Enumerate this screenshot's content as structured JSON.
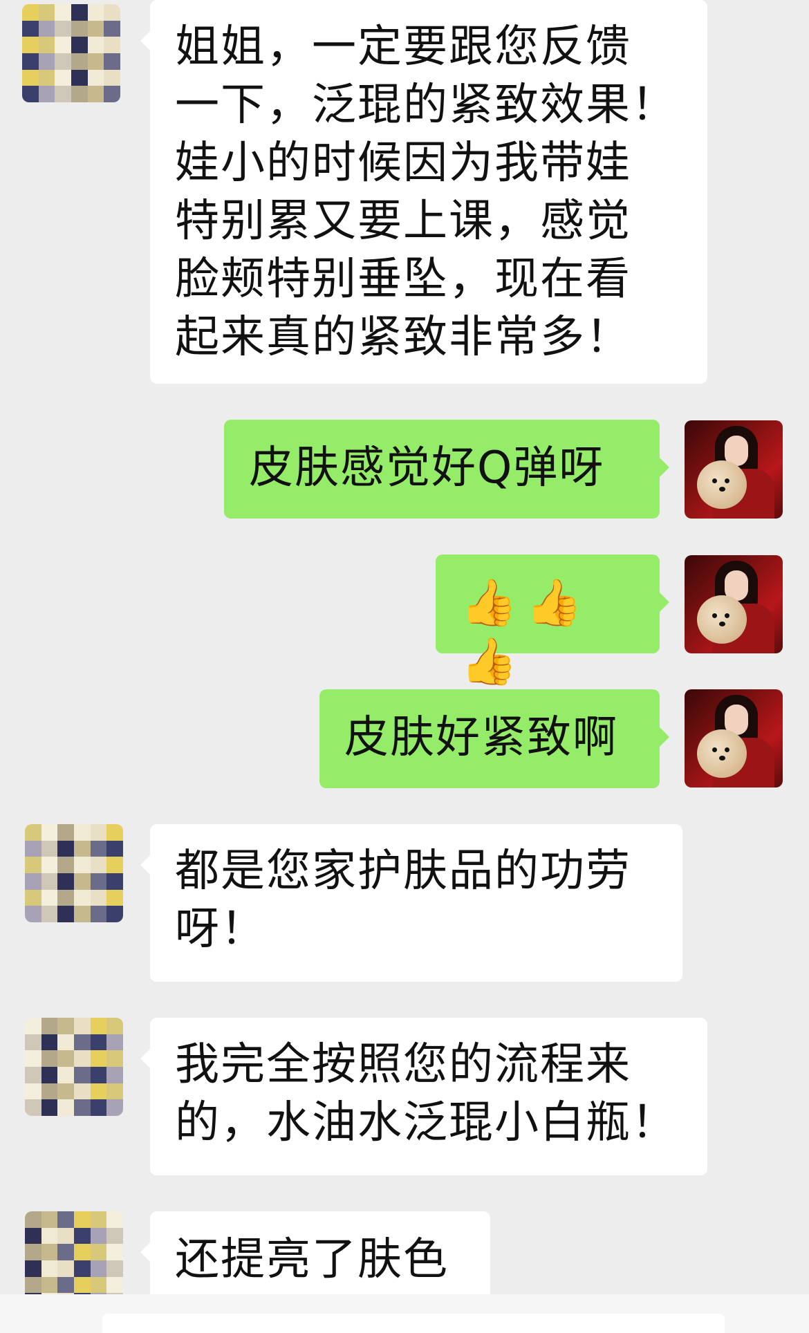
{
  "messages": [
    {
      "side": "in",
      "lines": [
        "姐姐，一定要跟您反馈",
        "一下，泛琨的紧致效果！",
        "娃小的时候因为我带娃",
        "特别累又要上课，感觉",
        "脸颊特别垂坠，现在看",
        "起来真的紧致非常多！"
      ]
    },
    {
      "side": "out",
      "text": "皮肤感觉好Q弹呀"
    },
    {
      "side": "out",
      "emoji": [
        "👍",
        "👍",
        "👍"
      ],
      "emoji_name": "thumbs-up"
    },
    {
      "side": "out",
      "text": "皮肤好紧致啊"
    },
    {
      "side": "in",
      "lines": [
        "都是您家护肤品的功劳",
        "呀！"
      ]
    },
    {
      "side": "in",
      "lines": [
        "我完全按照您的流程来",
        "的，水油水泛琨小白瓶！"
      ]
    },
    {
      "side": "in",
      "lines": [
        "还提亮了肤色"
      ]
    }
  ],
  "colors": {
    "background": "#ededed",
    "incoming_bubble": "#ffffff",
    "outgoing_bubble": "#95ec69",
    "text": "#111111"
  },
  "avatar_pixel_palette": [
    "#e8dfc4",
    "#3a3f6b",
    "#d8c97a",
    "#cfc7b8",
    "#b3a88a",
    "#f1ead4",
    "#6b6b8a",
    "#e6cf5c",
    "#a8a2b6",
    "#f4eedd",
    "#2e3155",
    "#c6b98e"
  ]
}
